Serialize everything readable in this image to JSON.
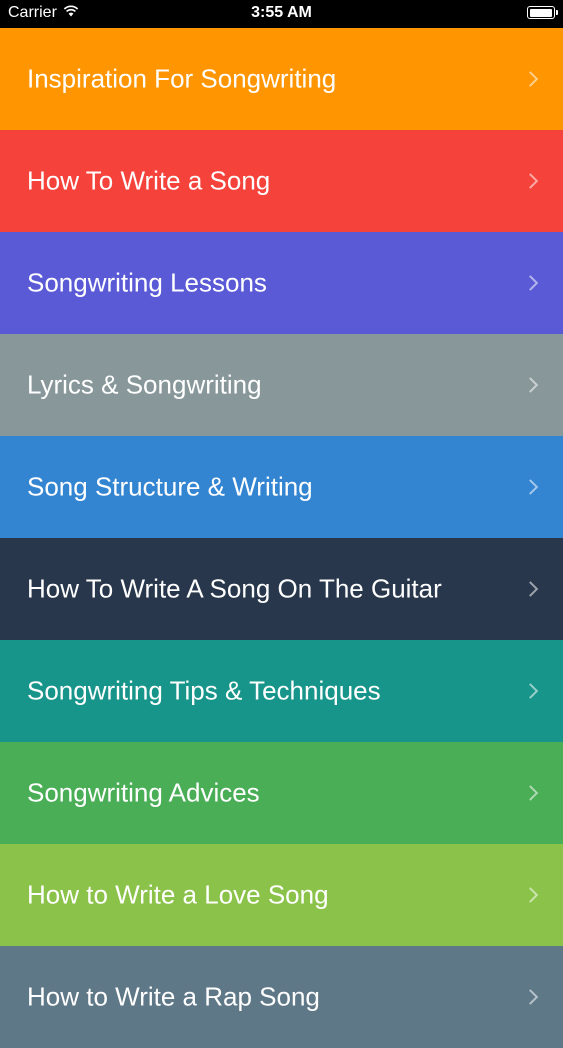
{
  "status_bar": {
    "carrier": "Carrier",
    "time": "3:55 AM",
    "wifi_icon": "wifi-icon",
    "battery_icon": "battery-icon",
    "battery_level": 1.0
  },
  "list": {
    "items": [
      {
        "label": "Inspiration For Songwriting",
        "color": "#FF9500"
      },
      {
        "label": "How To Write a Song",
        "color": "#F5423B"
      },
      {
        "label": "Songwriting Lessons",
        "color": "#5A5AD6"
      },
      {
        "label": "Lyrics & Songwriting",
        "color": "#889799"
      },
      {
        "label": "Song Structure & Writing",
        "color": "#3385D2"
      },
      {
        "label": "How To Write A Song On The Guitar",
        "color": "#28374B"
      },
      {
        "label": "Songwriting Tips & Techniques",
        "color": "#18958A"
      },
      {
        "label": "Songwriting Advices",
        "color": "#4AAE56"
      },
      {
        "label": "How to Write a Love Song",
        "color": "#8BC34A"
      },
      {
        "label": "How to Write a Rap Song",
        "color": "#5F7887"
      }
    ],
    "chevron_icon": "chevron-right-icon"
  }
}
